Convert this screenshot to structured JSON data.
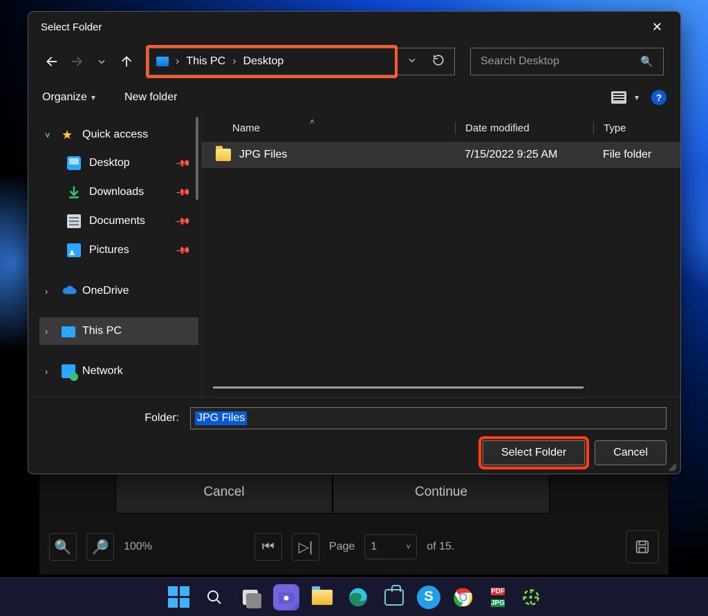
{
  "dialog": {
    "title": "Select Folder",
    "nav": {
      "back": "←",
      "fwd": "→",
      "recent": "˅",
      "up": "↑",
      "refresh": "⟳",
      "dropdown": "˅"
    },
    "breadcrumb": {
      "root": "This PC",
      "loc": "Desktop",
      "sep": "›"
    },
    "search": {
      "placeholder": "Search Desktop"
    },
    "toolbar": {
      "organize": "Organize",
      "newfolder": "New folder"
    },
    "columns": {
      "name": "Name",
      "date": "Date modified",
      "type": "Type"
    },
    "rows": [
      {
        "name": "JPG Files",
        "date": "7/15/2022 9:25 AM",
        "type": "File folder"
      }
    ],
    "folder_label": "Folder:",
    "folder_value": "JPG Files",
    "select_btn": "Select Folder",
    "cancel_btn": "Cancel"
  },
  "tree": {
    "quick": "Quick access",
    "desktop": "Desktop",
    "downloads": "Downloads",
    "documents": "Documents",
    "pictures": "Pictures",
    "onedrive": "OneDrive",
    "thispc": "This PC",
    "network": "Network"
  },
  "under": {
    "cancel": "Cancel",
    "continue": "Continue",
    "zoom": "100%",
    "page_label": "Page",
    "page_num": "1",
    "page_total": "of 15."
  },
  "taskbar": {
    "pdf": "PDF",
    "jpg": "JPG",
    "skype": "S"
  }
}
